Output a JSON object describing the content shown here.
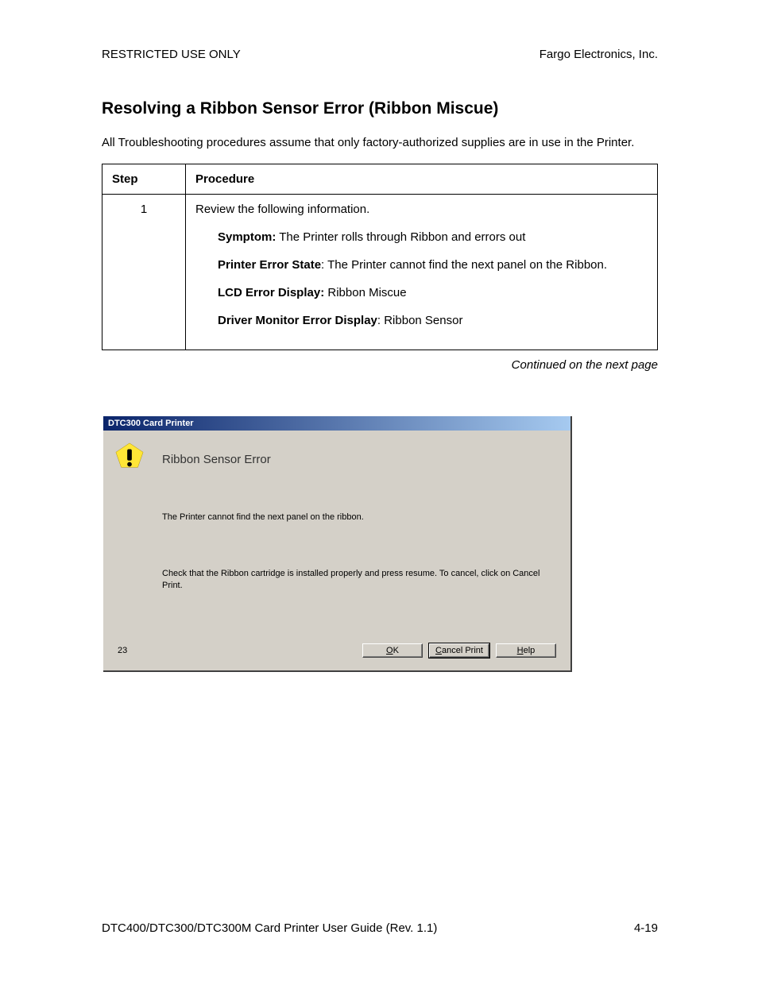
{
  "header": {
    "left": "RESTRICTED USE ONLY",
    "right": "Fargo Electronics, Inc."
  },
  "title": "Resolving a Ribbon Sensor Error (Ribbon Miscue)",
  "intro": "All Troubleshooting procedures assume that only factory-authorized supplies are in use in the Printer.",
  "table": {
    "head_step": "Step",
    "head_proc": "Procedure",
    "row1": {
      "step": "1",
      "lead": "Review the following information.",
      "symptom_label": "Symptom:",
      "symptom_text": " The Printer rolls through Ribbon and errors out",
      "state_label": "Printer Error State",
      "state_text": ": The Printer cannot find the next panel on the Ribbon.",
      "lcd_label": "LCD Error Display:",
      "lcd_text": " Ribbon Miscue",
      "driver_label": "Driver Monitor Error Display",
      "driver_text": ": Ribbon Sensor"
    }
  },
  "continued": "Continued on the next page",
  "dialog": {
    "title": "DTC300 Card Printer",
    "error_title": "Ribbon Sensor Error",
    "line1": "The Printer cannot find the next panel on the ribbon.",
    "line2": "Check that the Ribbon cartridge is installed properly and press resume. To cancel, click on Cancel Print.",
    "counter": "23",
    "btn_ok_accel": "O",
    "btn_ok_rest": "K",
    "btn_cancel_accel": "C",
    "btn_cancel_rest": "ancel Print",
    "btn_help_accel": "H",
    "btn_help_rest": "elp"
  },
  "footer": {
    "left": "DTC400/DTC300/DTC300M Card Printer User Guide (Rev. 1.1)",
    "right": "4-19"
  }
}
